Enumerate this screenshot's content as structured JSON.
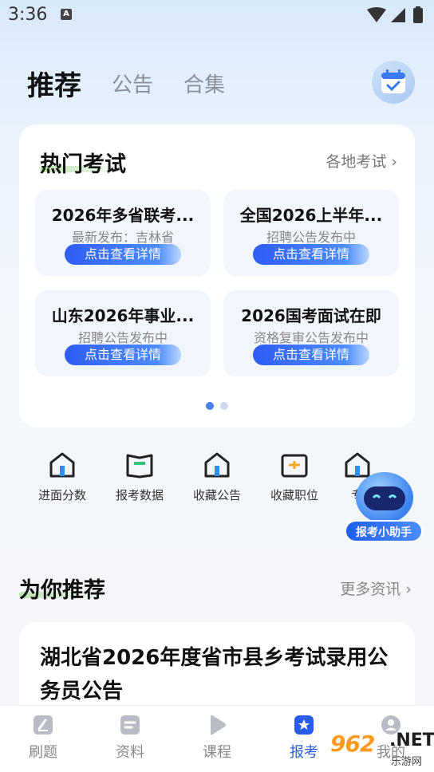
{
  "status_bar": {
    "time": "3:36",
    "notif_letter": "A"
  },
  "top_tabs": [
    {
      "label": "推荐",
      "active": true
    },
    {
      "label": "公告",
      "active": false
    },
    {
      "label": "合集",
      "active": false
    }
  ],
  "hot_exams": {
    "title": "热门考试",
    "more": "各地考试 ›",
    "items": [
      {
        "title": "2026年多省联考...",
        "sub": "最新发布：吉林省",
        "button": "点击查看详情"
      },
      {
        "title": "全国2026上半年...",
        "sub": "招聘公告发布中",
        "button": "点击查看详情"
      },
      {
        "title": "山东2026年事业...",
        "sub": "招聘公告发布中",
        "button": "点击查看详情"
      },
      {
        "title": "2026国考面试在即",
        "sub": "资格复审公告发布中",
        "button": "点击查看详情"
      }
    ],
    "page_index": 1,
    "page_count": 2
  },
  "shortcuts": [
    {
      "label": "进面分数",
      "icon": "house-chart-icon"
    },
    {
      "label": "报考数据",
      "icon": "book-data-icon"
    },
    {
      "label": "收藏公告",
      "icon": "house-star-icon"
    },
    {
      "label": "收藏职位",
      "icon": "briefcase-icon"
    },
    {
      "label": "专",
      "icon": "house-chart-icon"
    }
  ],
  "assistant": {
    "label": "报考小助手"
  },
  "recommend": {
    "title": "为你推荐",
    "more": "更多资讯 ›",
    "article_title": "湖北省2026年度省市县乡考试录用公务员公告"
  },
  "bottom_nav": [
    {
      "label": "刷题",
      "icon": "pen-icon",
      "active": false
    },
    {
      "label": "资料",
      "icon": "document-icon",
      "active": false
    },
    {
      "label": "课程",
      "icon": "play-icon",
      "active": false
    },
    {
      "label": "报考",
      "icon": "star-badge-icon",
      "active": true
    },
    {
      "label": "我的",
      "icon": "user-icon",
      "active": false
    }
  ],
  "watermark": {
    "number": "962",
    "net": ".NET",
    "sub": "乐游网"
  },
  "colors": {
    "accent": "#2a5cf0",
    "inactive": "#888888",
    "watermark": "#ff9a1f"
  }
}
